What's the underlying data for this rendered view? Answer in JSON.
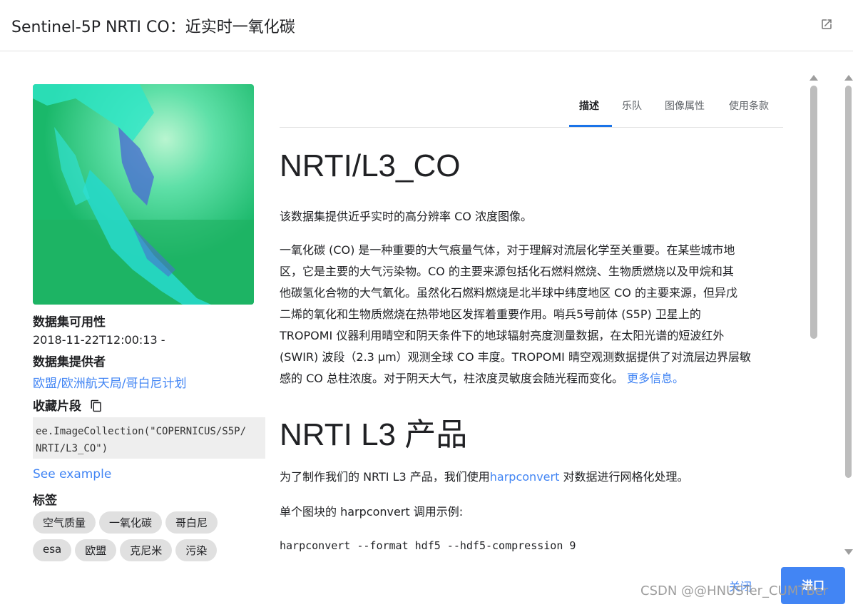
{
  "header": {
    "title": "Sentinel-5P NRTI CO：近实时一氧化碳"
  },
  "left": {
    "availability_label": "数据集可用性",
    "availability_value": "2018-11-22T12:00:13 -",
    "provider_label": "数据集提供者",
    "provider_link": "欧盟/欧洲航天局/哥白尼计划",
    "snippet_label": "收藏片段",
    "snippet_code": "ee.ImageCollection(\"COPERNICUS/S5P/\nNRTI/L3_CO\")",
    "see_example": "See example",
    "tags_label": "标签",
    "tags": [
      "空气质量",
      "一氧化碳",
      "哥白尼",
      "esa",
      "欧盟",
      "克尼米",
      "污染"
    ]
  },
  "tabs": [
    {
      "label": "描述",
      "active": true
    },
    {
      "label": "乐队",
      "active": false
    },
    {
      "label": "图像属性",
      "active": false
    },
    {
      "label": "使用条款",
      "active": false
    }
  ],
  "content": {
    "heading1": "NRTI/L3_CO",
    "intro": "该数据集提供近乎实时的高分辨率 CO 浓度图像。",
    "para_lines": [
      "一氧化碳 (CO) 是一种重要的大气痕量气体，对于理解对流层化学至关重要。在某些城市地",
      "区，它是主要的大气污染物。CO 的主要来源包括化石燃料燃烧、生物质燃烧以及甲烷和其",
      "他碳氢化合物的大气氧化。虽然化石燃料燃烧是北半球中纬度地区 CO 的主要来源，但异戊",
      "二烯的氧化和生物质燃烧在热带地区发挥着重要作用。哨兵5号前体 (S5P) 卫星上的",
      "TROPOMI 仪器利用晴空和阴天条件下的地球辐射亮度测量数据，在太阳光谱的短波红外",
      "(SWIR) 波段（2.3 μm）观测全球 CO 丰度。TROPOMI 晴空观测数据提供了对流层边界层敏",
      "感的 CO 总柱浓度。对于阴天大气，柱浓度灵敏度会随光程而变化。"
    ],
    "more_info": "更多信息。",
    "heading2": "NRTI L3 产品",
    "p2_before": "为了制作我们的 NRTI L3 产品，我们使用",
    "p2_link": "harpconvert",
    "p2_after": " 对数据进行网格化处理。",
    "p3": "单个图块的 harpconvert 调用示例:",
    "code_line": "harpconvert --format hdf5 --hdf5-compression 9"
  },
  "footer": {
    "close": "关闭",
    "import": "进口"
  },
  "watermark": "CSDN @@HNUSTer_CUMTBer",
  "colors": {
    "accent": "#4285f4",
    "tab_underline": "#1a73e8"
  }
}
